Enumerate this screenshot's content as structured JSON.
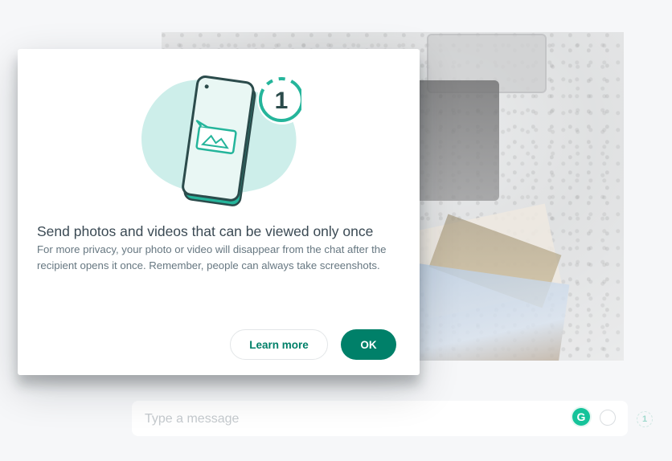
{
  "dialog": {
    "title": "Send photos and videos that can be viewed only once",
    "body": "For more privacy, your photo or video will disappear from the chat after the recipient opens it once. Remember, people can always take screenshots.",
    "learn_more_label": "Learn more",
    "ok_label": "OK",
    "illustration_badge": "1"
  },
  "composer": {
    "placeholder": "Type a message",
    "grammarly_glyph": "G",
    "view_once_glyph": "1"
  },
  "icons": {
    "illustration": "phone-view-once-illustration",
    "grammarly": "grammarly-icon",
    "emoji": "emoji-icon",
    "view_once": "view-once-icon"
  },
  "colors": {
    "accent": "#008069",
    "illustration_teal": "#25b59b",
    "illustration_blob": "#cdeeea",
    "title_text": "#3b4a54",
    "body_text": "#667781"
  }
}
